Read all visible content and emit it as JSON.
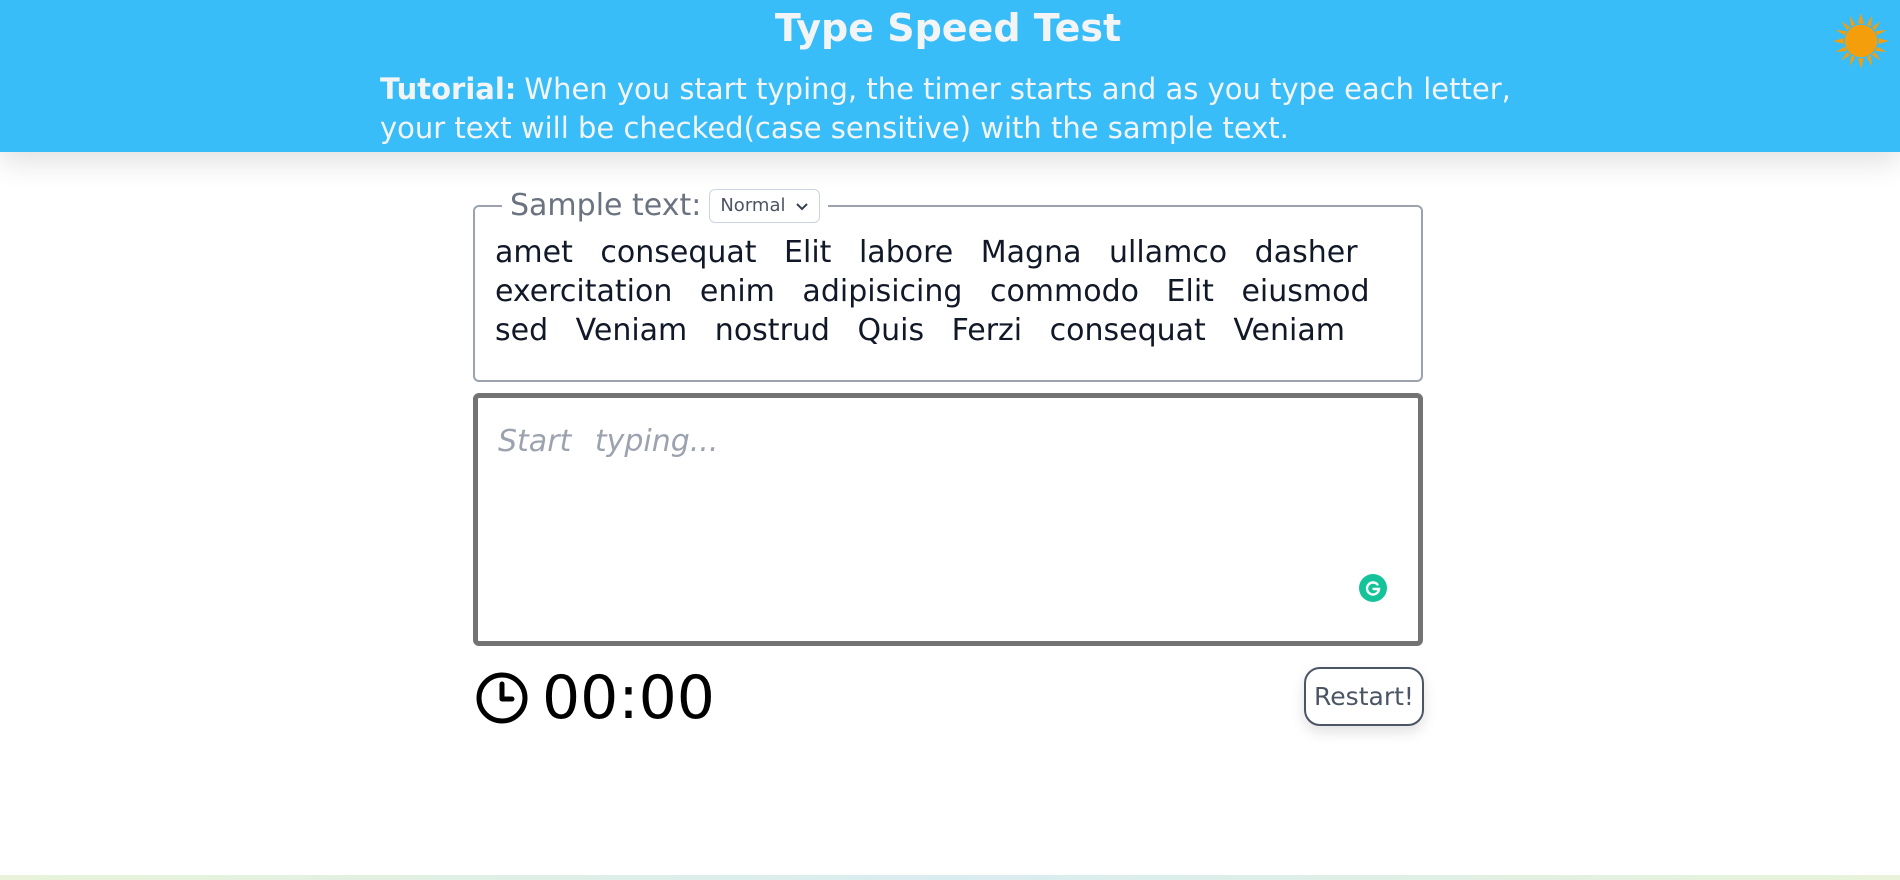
{
  "header": {
    "title": "Type Speed Test",
    "tutorial_label": "Tutorial:",
    "tutorial_text": "When you start typing, the timer starts and as you type each letter, your text will be checked(case sensitive) with the sample text.",
    "theme_icon": "sun-icon",
    "background_color": "#38bdf8"
  },
  "sample": {
    "label": "Sample text:",
    "mode_selected": "Normal",
    "text": "amet consequat Elit labore Magna ullamco dasher exercitation enim adipisicing commodo Elit eiusmod sed Veniam nostrud Quis Ferzi consequat Veniam"
  },
  "input": {
    "placeholder": "Start typing...",
    "value": ""
  },
  "timer": {
    "icon": "clock-icon",
    "value": "00:00"
  },
  "restart": {
    "label": "Restart!"
  }
}
